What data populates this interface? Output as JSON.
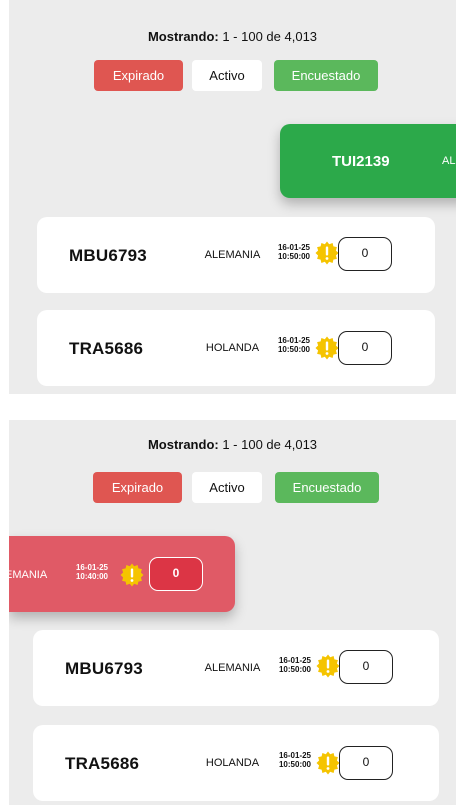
{
  "header": {
    "showing_label": "Mostrando:",
    "showing_range": "1 - 100 de 4,013"
  },
  "filters": {
    "expired": "Expirado",
    "active": "Activo",
    "surveyed": "Encuestado"
  },
  "colors": {
    "expired": "#df5651",
    "surveyed": "#5bb85c",
    "swipe_green": "#2ca94a",
    "swipe_red": "#e05a66",
    "warning_badge": "#f5c400"
  },
  "top_panel": {
    "swiped_card": {
      "code": "TUI2139",
      "country": "AL"
    },
    "cards": [
      {
        "code": "MBU6793",
        "country": "ALEMANIA",
        "date": "16-01-25",
        "time": "10:50:00",
        "count": "0"
      },
      {
        "code": "TRA5686",
        "country": "HOLANDA",
        "date": "16-01-25",
        "time": "10:50:00",
        "count": "0"
      }
    ]
  },
  "bottom_panel": {
    "swiped_card": {
      "country": "EMANIA",
      "date": "16-01-25",
      "time": "10:40:00",
      "count": "0"
    },
    "cards": [
      {
        "code": "MBU6793",
        "country": "ALEMANIA",
        "date": "16-01-25",
        "time": "10:50:00",
        "count": "0"
      },
      {
        "code": "TRA5686",
        "country": "HOLANDA",
        "date": "16-01-25",
        "time": "10:50:00",
        "count": "0"
      }
    ]
  }
}
